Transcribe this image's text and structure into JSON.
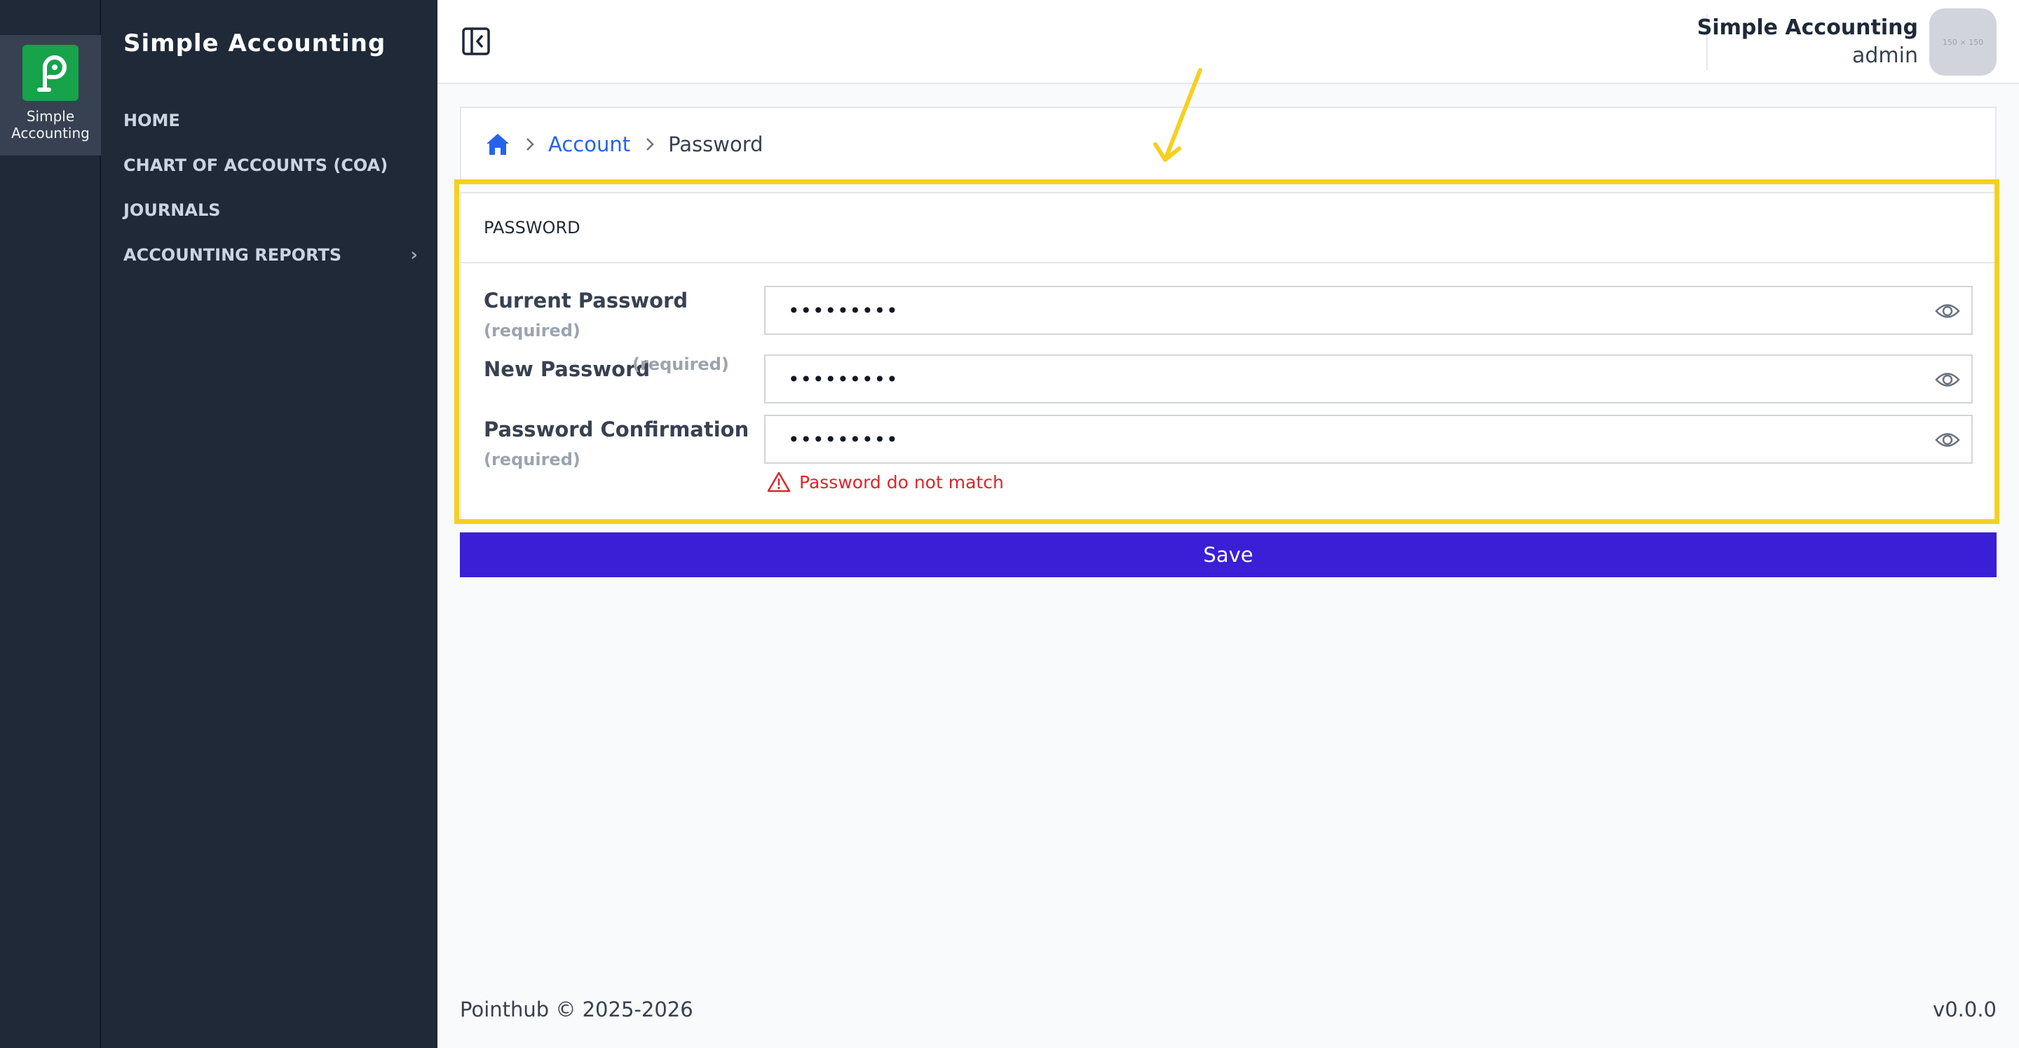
{
  "rail": {
    "app_label": "Simple Accounting",
    "logo_icon": "pointhub-logo-icon"
  },
  "sidebar": {
    "title": "Simple Accounting",
    "items": [
      {
        "label": "HOME"
      },
      {
        "label": "CHART OF ACCOUNTS (COA)"
      },
      {
        "label": "JOURNALS"
      },
      {
        "label": "ACCOUNTING REPORTS",
        "chevron": "›"
      }
    ]
  },
  "header": {
    "app_name": "Simple Accounting",
    "role": "admin",
    "avatar_placeholder": "150 × 150"
  },
  "breadcrumb": {
    "items": [
      {
        "label": "Account"
      },
      {
        "label": "Password"
      }
    ]
  },
  "form": {
    "title": "PASSWORD",
    "fields": [
      {
        "label": "Current Password",
        "required": "(required)",
        "value": "•••••••••"
      },
      {
        "label": "New Password",
        "required": "(required)",
        "value": "•••••••••"
      },
      {
        "label": "Password Confirmation",
        "required": "(required)",
        "value": "•••••••••"
      }
    ],
    "error": "Password do not match",
    "save_label": "Save"
  },
  "footer": {
    "copyright": "Pointhub © 2025-2026",
    "version": "v0.0.0"
  },
  "colors": {
    "sidebar_bg": "#1f2937",
    "accent": "#3a1fd6",
    "link": "#2563eb",
    "error": "#dc2626",
    "highlight": "#f5d020",
    "logo_green": "#16a34a"
  }
}
